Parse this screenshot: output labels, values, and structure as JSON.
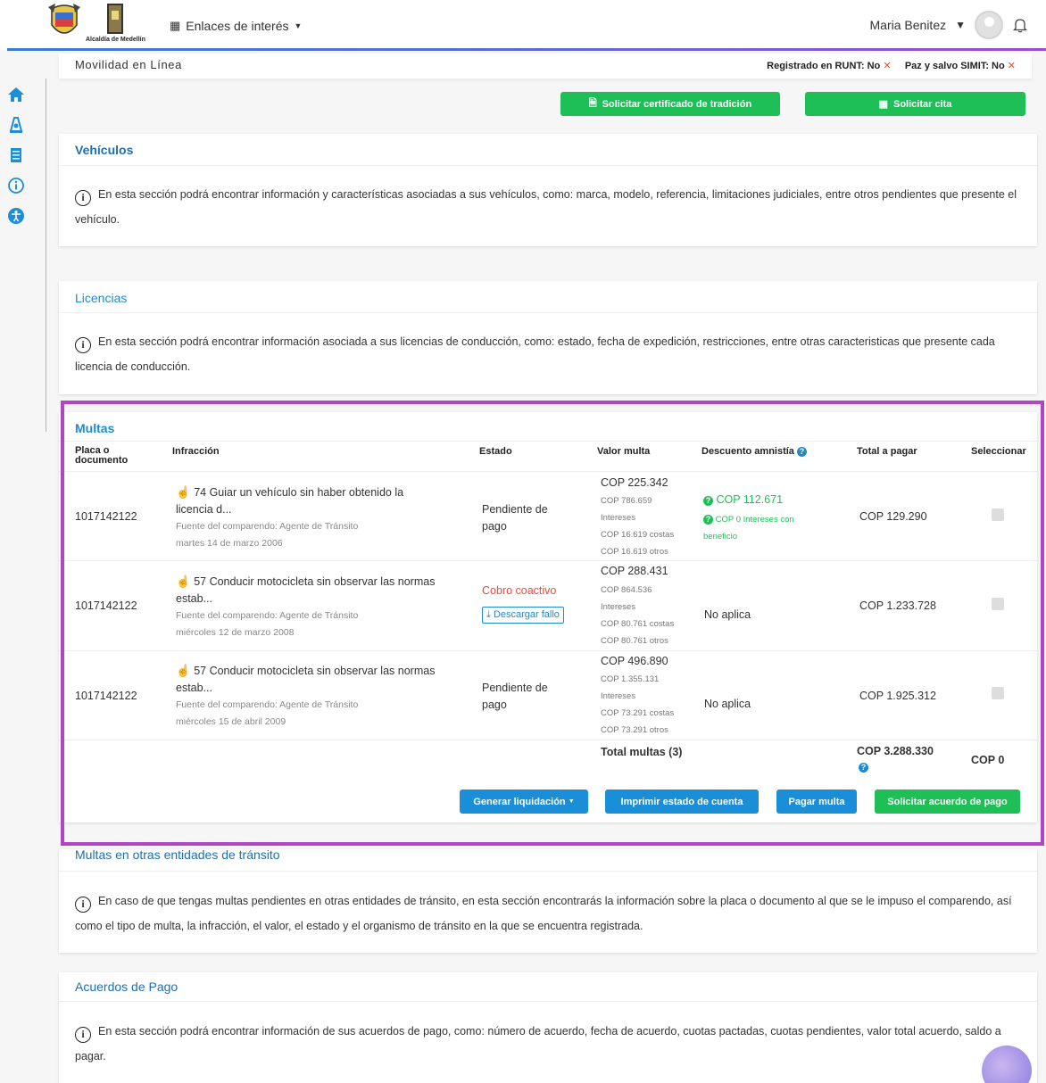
{
  "header": {
    "alcaldia_text": "Alcaldía de Medellín",
    "links_label": "Enlaces de interés",
    "user_name": "Maria Benitez"
  },
  "subheader": {
    "title": "Movilidad en Línea",
    "runt_label": "Registrado en RUNT: No",
    "simit_label": "Paz y salvo SIMIT: No"
  },
  "actions": {
    "certificado": "Solicitar certificado de tradición",
    "cita": "Solicitar cita"
  },
  "vehiculos": {
    "title": "Vehículos",
    "desc": "En esta sección podrá encontrar información y características asociadas a sus vehículos, como: marca, modelo, referencia, limitaciones judiciales, entre otros pendientes que presente el vehículo."
  },
  "licencias": {
    "title": "Licencias",
    "desc": "En esta sección podrá encontrar información asociada a sus licencias de conducción, como: estado, fecha de expedición, restricciones, entre otras caracteristicas que presente cada licencia de conducción."
  },
  "multas": {
    "title": "Multas",
    "headers": {
      "placa": "Placa o documento",
      "infraccion": "Infracción",
      "estado": "Estado",
      "valor": "Valor multa",
      "descuento": "Descuento amnistía",
      "total": "Total a pagar",
      "seleccionar": "Seleccionar"
    },
    "rows": [
      {
        "placa": "1017142122",
        "infraccion": "74 Guiar un vehículo sin haber obtenido la licencia d...",
        "fuente": "Fuente del comparendo: Agente de Tránsito",
        "fecha": "martes 14 de marzo 2006",
        "estado": "Pendiente de pago",
        "valor": "COP 225.342",
        "valor_d1": "COP 786.659",
        "valor_d2": "Intereses",
        "valor_d3": "COP 16.619 costas",
        "valor_d4": "COP 16.619 otros",
        "descuento": "COP 112.671",
        "descuento_sub": "COP 0 Intereses con beneficio",
        "total": "COP 129.290"
      },
      {
        "placa": "1017142122",
        "infraccion": "57 Conducir motocicleta sin observar las normas estab...",
        "fuente": "Fuente del comparendo: Agente de Tránsito",
        "fecha": "miércoles 12 de marzo 2008",
        "estado": "Cobro coactivo",
        "descargar": "Descargar fallo",
        "valor": "COP 288.431",
        "valor_d1": "COP 864.536",
        "valor_d2": "Intereses",
        "valor_d3": "COP 80.761 costas",
        "valor_d4": "COP 80.761 otros",
        "descuento": "No aplica",
        "total": "COP 1.233.728"
      },
      {
        "placa": "1017142122",
        "infraccion": "57 Conducir motocicleta sin observar las normas estab...",
        "fuente": "Fuente del comparendo: Agente de Tránsito",
        "fecha": "miércoles 15 de abril 2009",
        "estado": "Pendiente de pago",
        "valor": "COP 496.890",
        "valor_d1": "COP 1.355.131",
        "valor_d2": "Intereses",
        "valor_d3": "COP 73.291 costas",
        "valor_d4": "COP 73.291 otros",
        "descuento": "No aplica",
        "total": "COP 1.925.312"
      }
    ],
    "total_label": "Total multas (3)",
    "total_value": "COP 3.288.330",
    "selected_value": "COP 0",
    "buttons": {
      "generar": "Generar liquidación",
      "imprimir": "Imprimir estado de cuenta",
      "pagar": "Pagar multa",
      "acuerdo": "Solicitar acuerdo de pago"
    }
  },
  "otras": {
    "title": "Multas en otras entidades de tránsito",
    "desc": "En caso de que tengas multas pendientes en otras entidades de tránsito, en esta sección encontrarás la información sobre la placa o documento al que se le impuso el comparendo, así como el tipo de multa, la infracción, el valor, el estado y el organismo de tránsito en la que se encuentra registrada."
  },
  "acuerdos": {
    "title": "Acuerdos de Pago",
    "desc": "En esta sección podrá encontrar información de sus acuerdos de pago, como: número de acuerdo, fecha de acuerdo, cuotas pactadas, cuotas pendientes, valor total acuerdo, saldo a pagar."
  },
  "colors": {
    "accent_blue": "#1d8bd0",
    "green": "#1fbf57",
    "highlight": "#b046c4",
    "danger": "#e74c3c"
  }
}
